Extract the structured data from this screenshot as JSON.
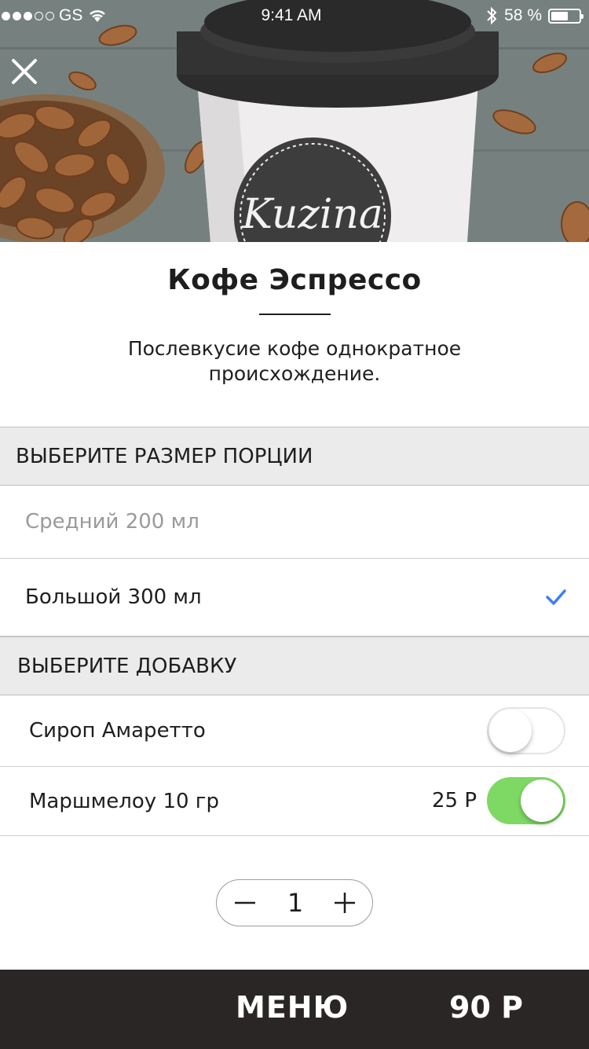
{
  "status_bar": {
    "carrier": "GS",
    "time": "9:41 AM",
    "battery": "58 %",
    "battery_level": 0.58
  },
  "product": {
    "title": "Кофе Эспрессо",
    "description_line1": "Послевкусие кофе однократное",
    "description_line2": "происхождение.",
    "cup_brand": "Kuzina"
  },
  "size_section": {
    "header": "ВЫБЕРИТЕ РАЗМЕР ПОРЦИИ",
    "options": [
      {
        "label": "Средний 200 мл",
        "selected": false
      },
      {
        "label": "Большой 300 мл",
        "selected": true
      }
    ]
  },
  "addon_section": {
    "header": "ВЫБЕРИТЕ ДОБАВКУ",
    "items": [
      {
        "label": "Сироп Амаретто",
        "price": "",
        "enabled": false
      },
      {
        "label": "Маршмелоу 10 гр",
        "price": "25 Р",
        "enabled": true
      }
    ]
  },
  "quantity": "1",
  "bottom_bar": {
    "menu_label": "МЕНЮ",
    "total": "90 Р"
  },
  "colors": {
    "accent_check": "#3d7ef0",
    "toggle_on": "#7ed864",
    "bottom_bar": "#2a2625",
    "section_bg": "#ebebeb"
  }
}
